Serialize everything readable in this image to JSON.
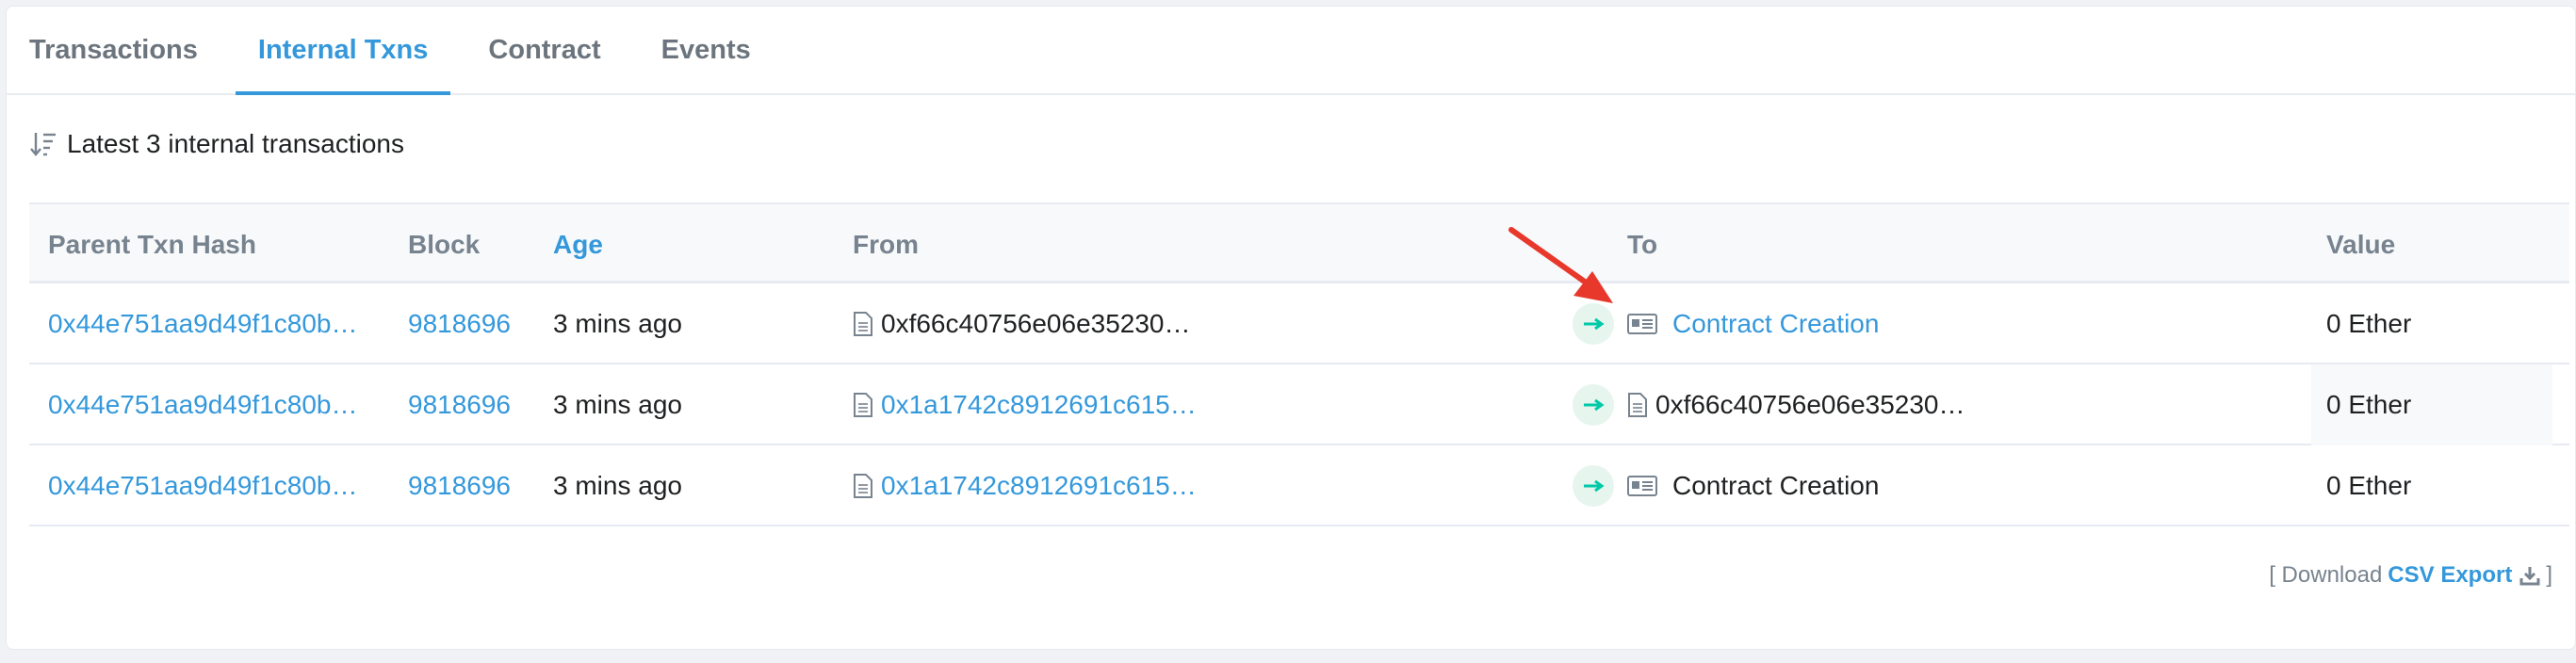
{
  "tabs": [
    "Transactions",
    "Internal Txns",
    "Contract",
    "Events"
  ],
  "active_tab": "Internal Txns",
  "summary": "Latest 3 internal transactions",
  "columns": {
    "parent": "Parent Txn Hash",
    "block": "Block",
    "age": "Age",
    "from": "From",
    "to": "To",
    "value": "Value"
  },
  "rows": [
    {
      "parent": "0x44e751aa9d49f1c80b…",
      "block": "9818696",
      "age": "3 mins ago",
      "from": "0xf66c40756e06e35230…",
      "to": "Contract Creation",
      "value": "0 Ether"
    },
    {
      "parent": "0x44e751aa9d49f1c80b…",
      "block": "9818696",
      "age": "3 mins ago",
      "from": "0x1a1742c8912691c615…",
      "to": "0xf66c40756e06e35230…",
      "value": "0 Ether"
    },
    {
      "parent": "0x44e751aa9d49f1c80b…",
      "block": "9818696",
      "age": "3 mins ago",
      "from": "0x1a1742c8912691c615…",
      "to": "Contract Creation",
      "value": "0 Ether"
    }
  ],
  "footer": {
    "prefix": "[ Download",
    "csv_label": "CSV Export",
    "suffix": "]"
  },
  "colors": {
    "accent": "#3498db",
    "arrow_green": "#00c9a7",
    "annotation_red": "#e8382b"
  }
}
